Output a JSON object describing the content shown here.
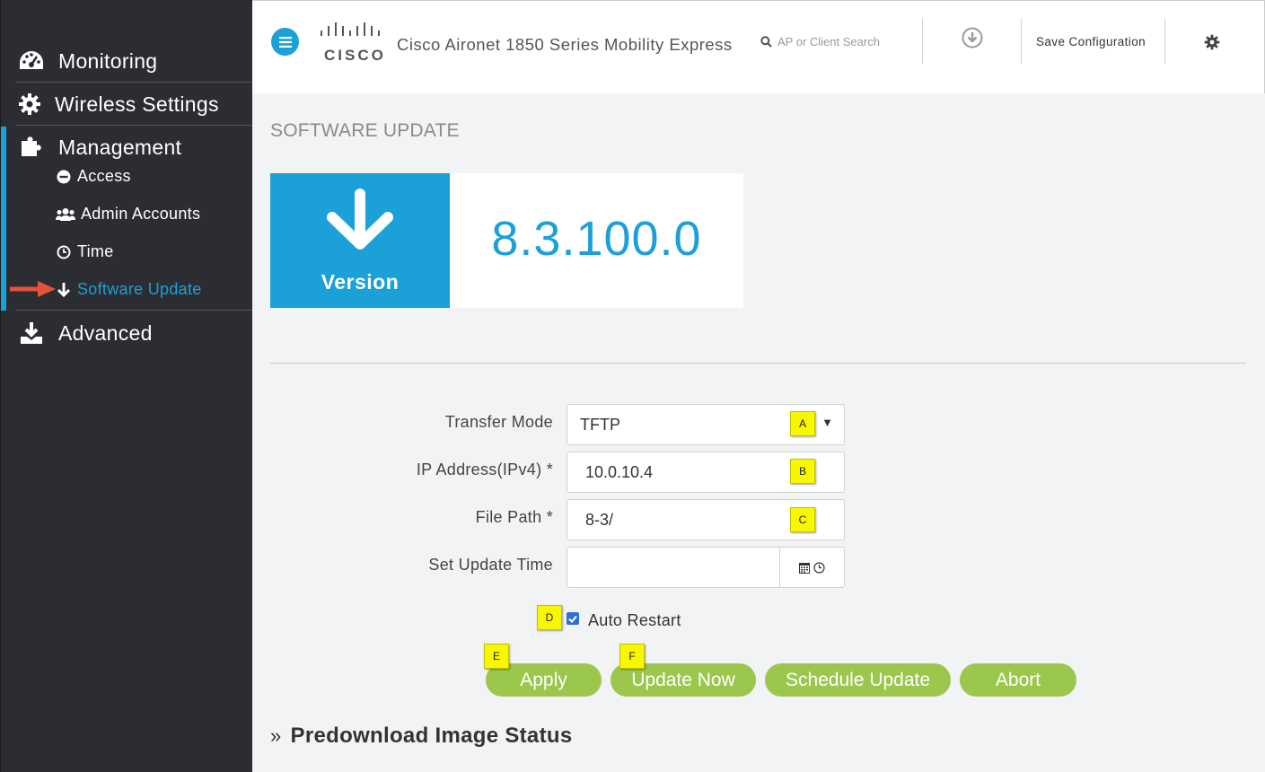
{
  "sidebar": {
    "monitoring": "Monitoring",
    "wireless": "Wireless Settings",
    "management": "Management",
    "sub_items": [
      "Access",
      "Admin Accounts",
      "Time",
      "Software Update"
    ],
    "advanced": "Advanced"
  },
  "header": {
    "logo_text": "CISCO",
    "product": "Cisco Aironet 1850 Series Mobility Express",
    "search_placeholder": "AP or Client Search",
    "save_config": "Save Configuration"
  },
  "page": {
    "title": "SOFTWARE UPDATE",
    "version_label": "Version",
    "version_value": "8.3.100.0"
  },
  "form": {
    "transfer_mode_label": "Transfer Mode",
    "transfer_mode_value": "TFTP",
    "ip_label": "IP Address(IPv4) *",
    "ip_value": "10.0.10.4",
    "path_label": "File Path *",
    "path_value": "8-3/",
    "time_label": "Set Update Time",
    "time_value": "",
    "auto_restart_label": "Auto Restart",
    "auto_restart_checked": true
  },
  "markers": [
    "A",
    "B",
    "C",
    "D",
    "E",
    "F"
  ],
  "buttons": {
    "apply": "Apply",
    "update_now": "Update Now",
    "schedule": "Schedule Update",
    "abort": "Abort"
  },
  "predownload": {
    "chevron": "»",
    "title": "Predownload Image Status"
  },
  "colors": {
    "accent": "#1ba0d7",
    "sidebar": "#2c2d32",
    "button_green": "#9bc74d",
    "marker_yellow": "#f7f700",
    "arrow_red": "#e5533d"
  },
  "icons": {
    "monitoring": "dashboard-icon",
    "wireless": "gear-icon",
    "management": "puzzle-icon",
    "access": "minus-circle-icon",
    "admin_accounts": "users-icon",
    "time": "clock-icon",
    "software_update": "arrow-down-icon",
    "advanced": "download-tray-icon"
  }
}
